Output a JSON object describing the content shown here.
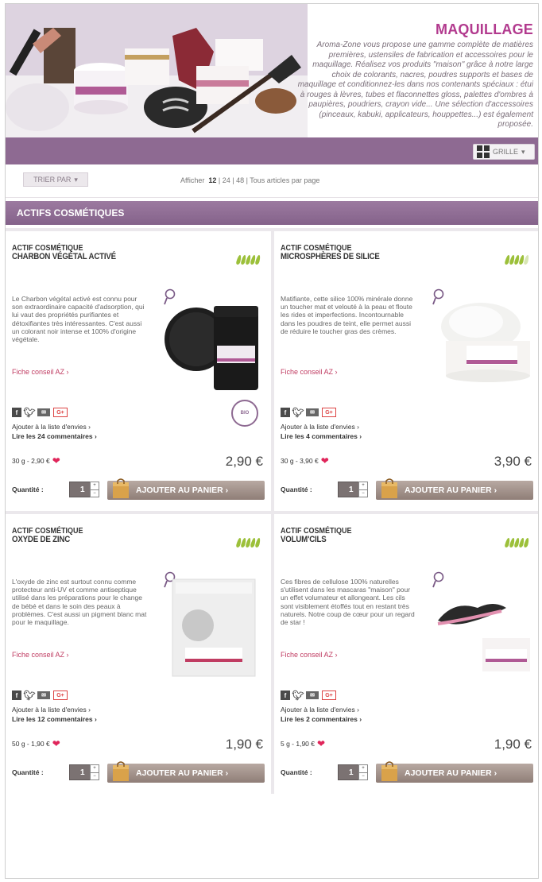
{
  "banner": {
    "title": "MAQUILLAGE",
    "text": "Aroma-Zone vous propose une gamme complète de matières premières, ustensiles de fabrication et accessoires pour le maquillage. Réalisez vos produits \"maison\" grâce à notre large choix de colorants, nacres, poudres supports et bases de maquillage et conditionnez-les dans nos contenants spéciaux : étui à rouges à lèvres, tubes et flaconnettes gloss, palettes d'ombres à paupières, poudriers, crayon vide... Une sélection d'accessoires (pinceaux, kabuki, applicateurs, houppettes...) est également proposée."
  },
  "toolbar": {
    "view_label": "GRILLE"
  },
  "sort": {
    "label": "TRIER PAR",
    "show_label": "Afficher",
    "opt_12": "12",
    "opt_24": "24",
    "opt_48": "48",
    "all_label": "Tous articles par page"
  },
  "section": {
    "title": "ACTIFS COSMÉTIQUES"
  },
  "products": [
    {
      "category": "ACTIF COSMÉTIQUE",
      "name": "CHARBON VÉGÉTAL ACTIVÉ",
      "leaves": 5,
      "desc": "Le Charbon végétal activé est connu pour son extraordinaire capacité d'adsorption, qui lui vaut des propriétés purifiantes et détoxifiantes très intéressantes. C'est aussi un colorant noir intense et 100% d'origine végétale.",
      "fiche": "Fiche conseil AZ",
      "wishlist": "Ajouter à la liste d'envies",
      "reviews": "Lire les 24 commentaires",
      "weight": "30 g - 2,90 €",
      "price": "2,90 €",
      "qty_label": "Quantité :",
      "qty": "1",
      "add_label": "AJOUTER AU PANIER",
      "badge": "BIO"
    },
    {
      "category": "ACTIF COSMÉTIQUE",
      "name": "MICROSPHÈRES DE SILICE",
      "leaves": 4,
      "desc": "Matifiante, cette silice 100% minérale donne un toucher mat et velouté à la peau et floute les rides et imperfections. Incontournable dans les poudres de teint, elle permet aussi de réduire le toucher gras des crèmes.",
      "fiche": "Fiche conseil AZ",
      "wishlist": "Ajouter à la liste d'envies",
      "reviews": "Lire les 4 commentaires",
      "weight": "30 g - 3,90 €",
      "price": "3,90 €",
      "qty_label": "Quantité :",
      "qty": "1",
      "add_label": "AJOUTER AU PANIER"
    },
    {
      "category": "ACTIF COSMÉTIQUE",
      "name": "OXYDE DE ZINC",
      "leaves": 5,
      "desc": "L'oxyde de zinc est surtout connu comme protecteur anti-UV et comme antiseptique utilisé dans les préparations pour le change de bébé et dans le soin des peaux à problèmes. C'est aussi un pigment blanc mat pour le maquillage.",
      "fiche": "Fiche conseil AZ",
      "wishlist": "Ajouter à la liste d'envies",
      "reviews": "Lire les 12 commentaires",
      "weight": "50 g - 1,90 €",
      "price": "1,90 €",
      "qty_label": "Quantité :",
      "qty": "1",
      "add_label": "AJOUTER AU PANIER"
    },
    {
      "category": "ACTIF COSMÉTIQUE",
      "name": "VOLUM'CILS",
      "leaves": 5,
      "desc": "Ces fibres de cellulose 100% naturelles s'utilisent dans les mascaras \"maison\" pour un effet volumateur et allongeant. Les cils sont visiblement étoffés tout en restant très naturels. Notre coup de cœur pour un regard de star !",
      "fiche": "Fiche conseil AZ",
      "wishlist": "Ajouter à la liste d'envies",
      "reviews": "Lire les 2 commentaires",
      "weight": "5 g - 1,90 €",
      "price": "1,90 €",
      "qty_label": "Quantité :",
      "qty": "1",
      "add_label": "AJOUTER AU PANIER"
    }
  ],
  "colors": {
    "purple": "#8e6a92",
    "title_pink": "#b23a8e",
    "link_red": "#c03c62",
    "leaf_green": "#9cc03a"
  }
}
